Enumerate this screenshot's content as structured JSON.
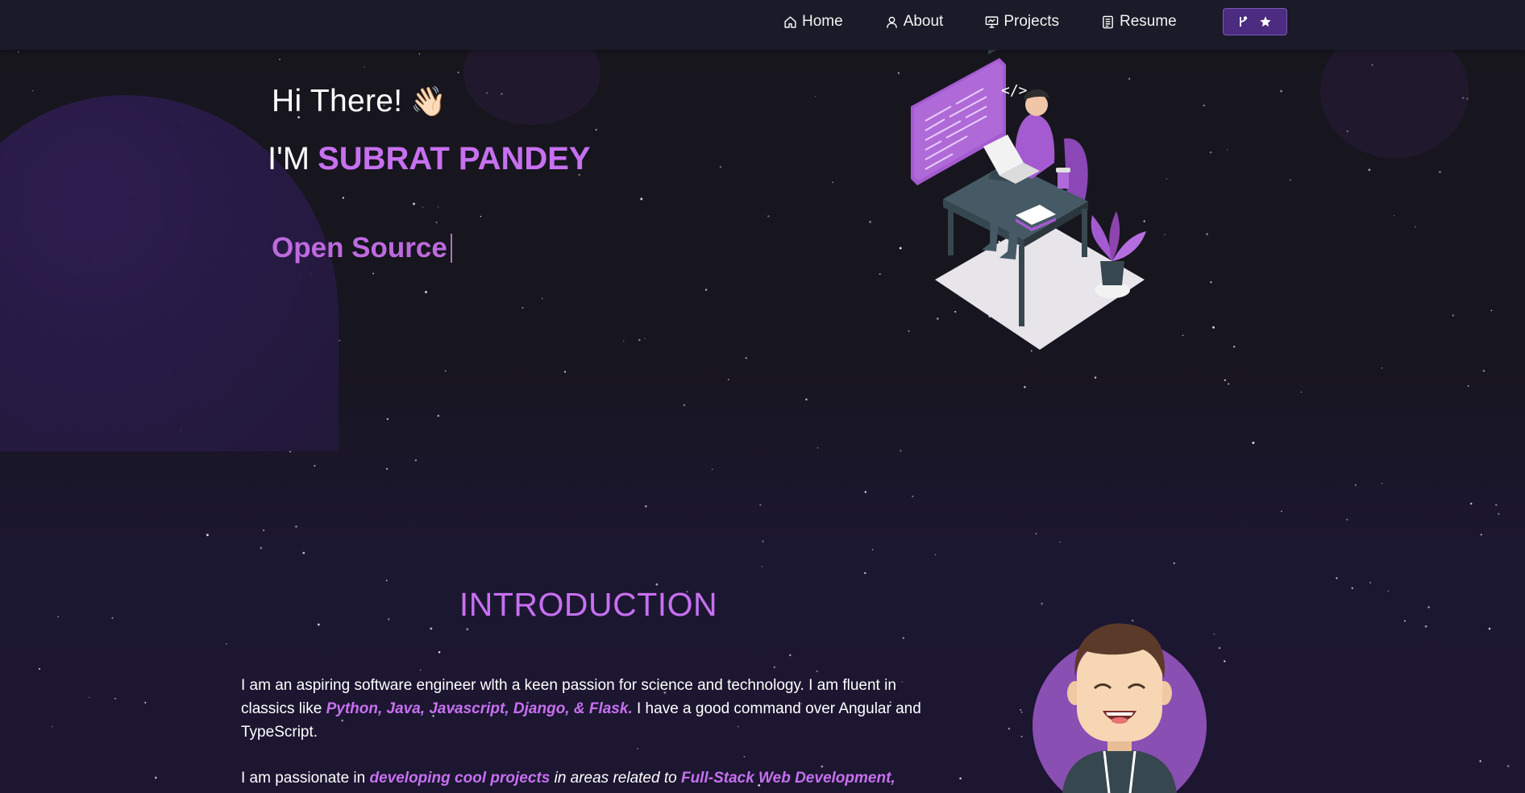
{
  "nav": {
    "items": [
      {
        "label": "Home",
        "icon": "home-icon"
      },
      {
        "label": "About",
        "icon": "user-icon"
      },
      {
        "label": "Projects",
        "icon": "projects-icon"
      },
      {
        "label": "Resume",
        "icon": "resume-icon"
      }
    ],
    "github_button": {
      "icons": [
        "fork-icon",
        "star-icon"
      ]
    }
  },
  "hero": {
    "greeting": "Hi There!",
    "wave_emoji": "👋🏻",
    "name_prefix": "I'M",
    "name": "SUBRAT PANDEY",
    "typed_text": "Open Source",
    "illustration": "developer-at-desk-illustration"
  },
  "intro": {
    "heading": "INTRODUCTION",
    "p1_a": "I am an aspiring software engineer with a keen passion for science and technology. I am fluent in classics like ",
    "p1_hl": "Python, Java, Javascript, Django, & Flask.",
    "p1_b": " I have a good command over Angular and TypeScript.",
    "p2_a": "I am passionate in ",
    "p2_hl1": "developing cool projects",
    "p2_b": " in areas related to ",
    "p2_hl2": "Full-Stack Web Development,",
    "avatar": "avatar-illustration"
  },
  "colors": {
    "accent": "#c770f0",
    "navbar_bg": "#1a1a28",
    "page_bg": "#17151f",
    "button_bg": "#4b2c80"
  }
}
